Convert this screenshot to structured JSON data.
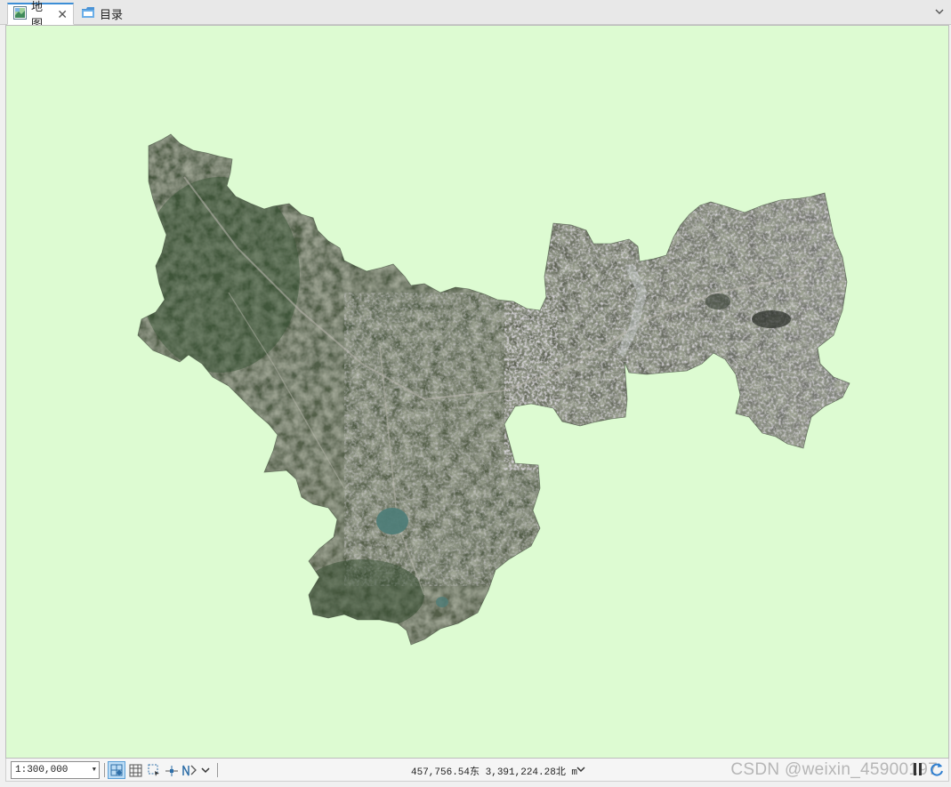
{
  "tabs": [
    {
      "label": "地图",
      "icon": "map-icon",
      "active": true,
      "closable": true
    },
    {
      "label": "目录",
      "icon": "catalog-folder-icon",
      "active": false,
      "closable": false
    }
  ],
  "tab_close_glyph": "✕",
  "map": {
    "background_color": "#ddfbd2",
    "layer_type": "satellite-imagery"
  },
  "status": {
    "scale": "1:300,000",
    "coordinates": "457,756.54东 3,391,224.28北 m",
    "watermark": "CSDN @weixin_45900197"
  },
  "colors": {
    "accent": "#3c8ed6",
    "active_tool": "#bcdcf5"
  }
}
